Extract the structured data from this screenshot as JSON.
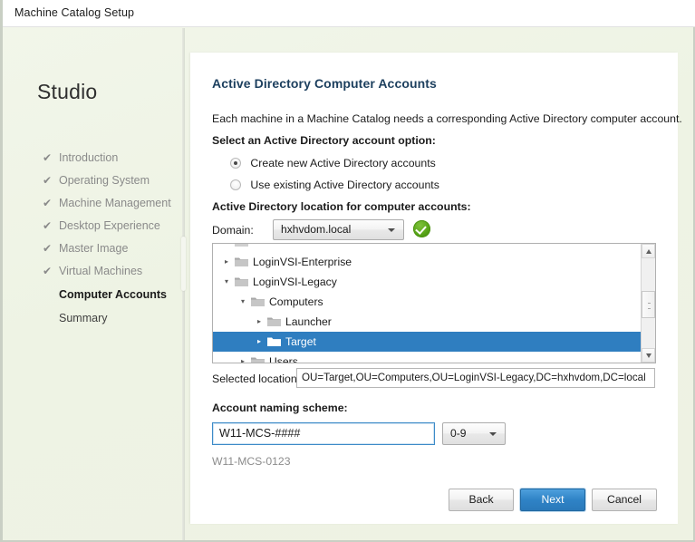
{
  "window": {
    "title": "Machine Catalog Setup"
  },
  "sidebar": {
    "logo": "Studio",
    "check_glyph": "✔",
    "items": [
      {
        "label": "Introduction",
        "state": "done"
      },
      {
        "label": "Operating System",
        "state": "done"
      },
      {
        "label": "Machine Management",
        "state": "done"
      },
      {
        "label": "Desktop Experience",
        "state": "done"
      },
      {
        "label": "Master Image",
        "state": "done"
      },
      {
        "label": "Virtual Machines",
        "state": "done"
      },
      {
        "label": "Computer Accounts",
        "state": "current"
      },
      {
        "label": "Summary",
        "state": "pending"
      }
    ]
  },
  "main": {
    "page_title": "Active Directory Computer Accounts",
    "intro": "Each machine in a Machine Catalog needs a corresponding Active Directory computer account.",
    "select_option_label": "Select an Active Directory account option:",
    "options": [
      {
        "label": "Create new Active Directory accounts",
        "selected": true
      },
      {
        "label": "Use existing Active Directory accounts",
        "selected": false
      }
    ],
    "ad_location_label": "Active Directory location for computer accounts:",
    "domain": {
      "label": "Domain:",
      "value": "hxhvdom.local",
      "status": "valid",
      "status_color": "#56a216"
    },
    "tree": {
      "nodes": [
        {
          "label": "LoginVSI-Enterprise",
          "depth": 0,
          "twisty": "collapsed",
          "selected": false
        },
        {
          "label": "LoginVSI-Legacy",
          "depth": 0,
          "twisty": "expanded",
          "selected": false
        },
        {
          "label": "Computers",
          "depth": 1,
          "twisty": "expanded",
          "selected": false
        },
        {
          "label": "Launcher",
          "depth": 2,
          "twisty": "collapsed",
          "selected": false
        },
        {
          "label": "Target",
          "depth": 2,
          "twisty": "collapsed",
          "selected": true
        },
        {
          "label": "Users",
          "depth": 1,
          "twisty": "collapsed",
          "selected": false
        }
      ],
      "selection_color": "#2f7ec0"
    },
    "selected_location": {
      "label": "Selected location:",
      "value": "OU=Target,OU=Computers,OU=LoginVSI-Legacy,DC=hxhvdom,DC=local"
    },
    "naming": {
      "label": "Account naming scheme:",
      "value": "W11-MCS-####",
      "digits": "0-9",
      "preview": "W11-MCS-0123"
    }
  },
  "footer": {
    "back": "Back",
    "next": "Next",
    "cancel": "Cancel",
    "next_color": "#2f83c6"
  }
}
